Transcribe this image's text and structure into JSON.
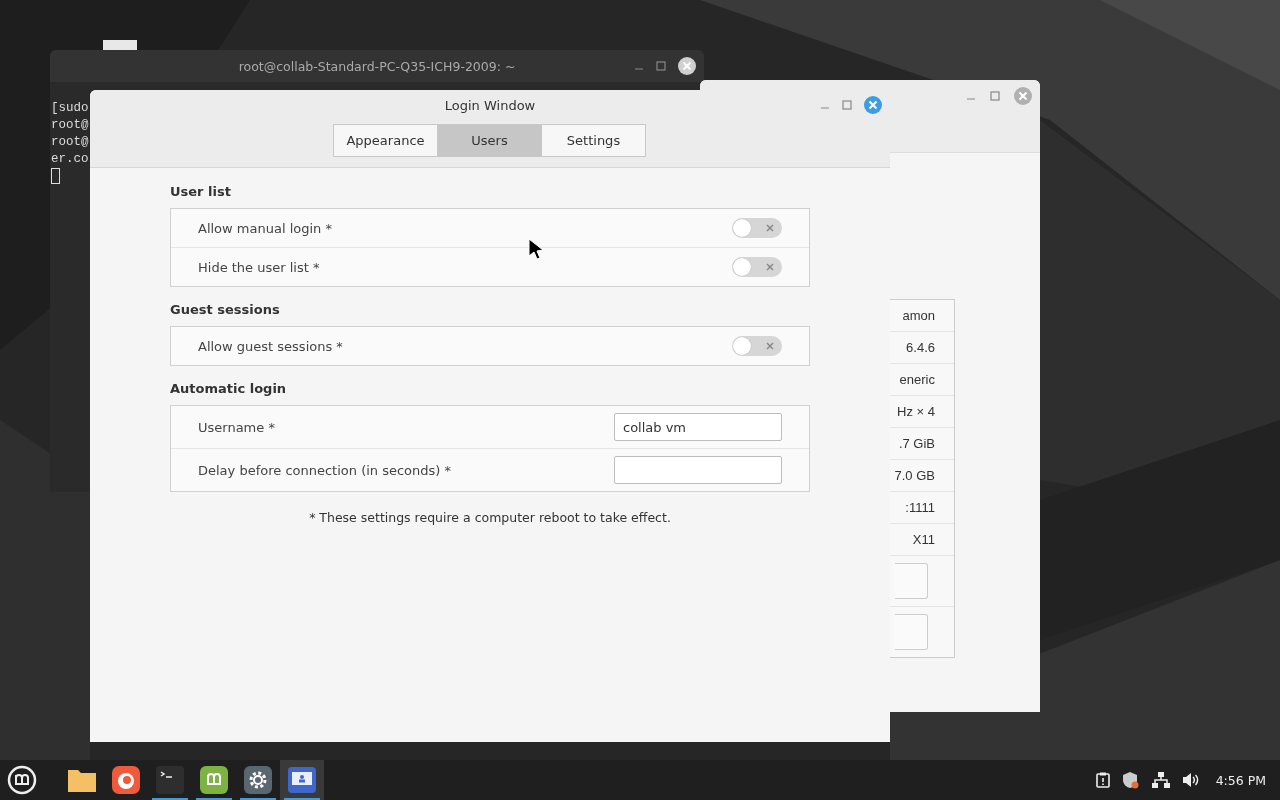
{
  "terminal_window": {
    "title": "root@collab-Standard-PC-Q35-ICH9-2009: ~",
    "lines": [
      "[sudo",
      "root@",
      "root@",
      "er.co"
    ]
  },
  "system_info_window": {
    "values": [
      "amon",
      "6.4.6",
      "eneric",
      "Hz × 4",
      ".7 GiB",
      "7.0 GB",
      ":1111",
      "X11"
    ]
  },
  "login_window": {
    "title": "Login Window",
    "tabs": [
      {
        "label": "Appearance",
        "selected": false
      },
      {
        "label": "Users",
        "selected": true
      },
      {
        "label": "Settings",
        "selected": false
      }
    ],
    "sections": [
      {
        "heading": "User list",
        "rows": [
          {
            "kind": "switch",
            "label": "Allow manual login *",
            "on": false
          },
          {
            "kind": "switch",
            "label": "Hide the user list *",
            "on": false
          }
        ]
      },
      {
        "heading": "Guest sessions",
        "rows": [
          {
            "kind": "switch",
            "label": "Allow guest sessions *",
            "on": false
          }
        ]
      },
      {
        "heading": "Automatic login",
        "rows": [
          {
            "kind": "entry",
            "label": "Username *",
            "value": "collab vm"
          },
          {
            "kind": "entry",
            "label": "Delay before connection (in seconds) *"
          }
        ]
      }
    ],
    "note": "* These settings require a computer reboot to take effect."
  },
  "taskbar": {
    "launchers": [
      {
        "kind": "files",
        "running": false,
        "active": false
      },
      {
        "kind": "browser",
        "running": false,
        "active": false
      },
      {
        "kind": "terminal",
        "running": true,
        "active": false
      },
      {
        "kind": "software",
        "running": true,
        "active": false
      },
      {
        "kind": "settings",
        "running": true,
        "active": false
      },
      {
        "kind": "login",
        "running": true,
        "active": true
      }
    ],
    "clock": "4:56 PM"
  }
}
